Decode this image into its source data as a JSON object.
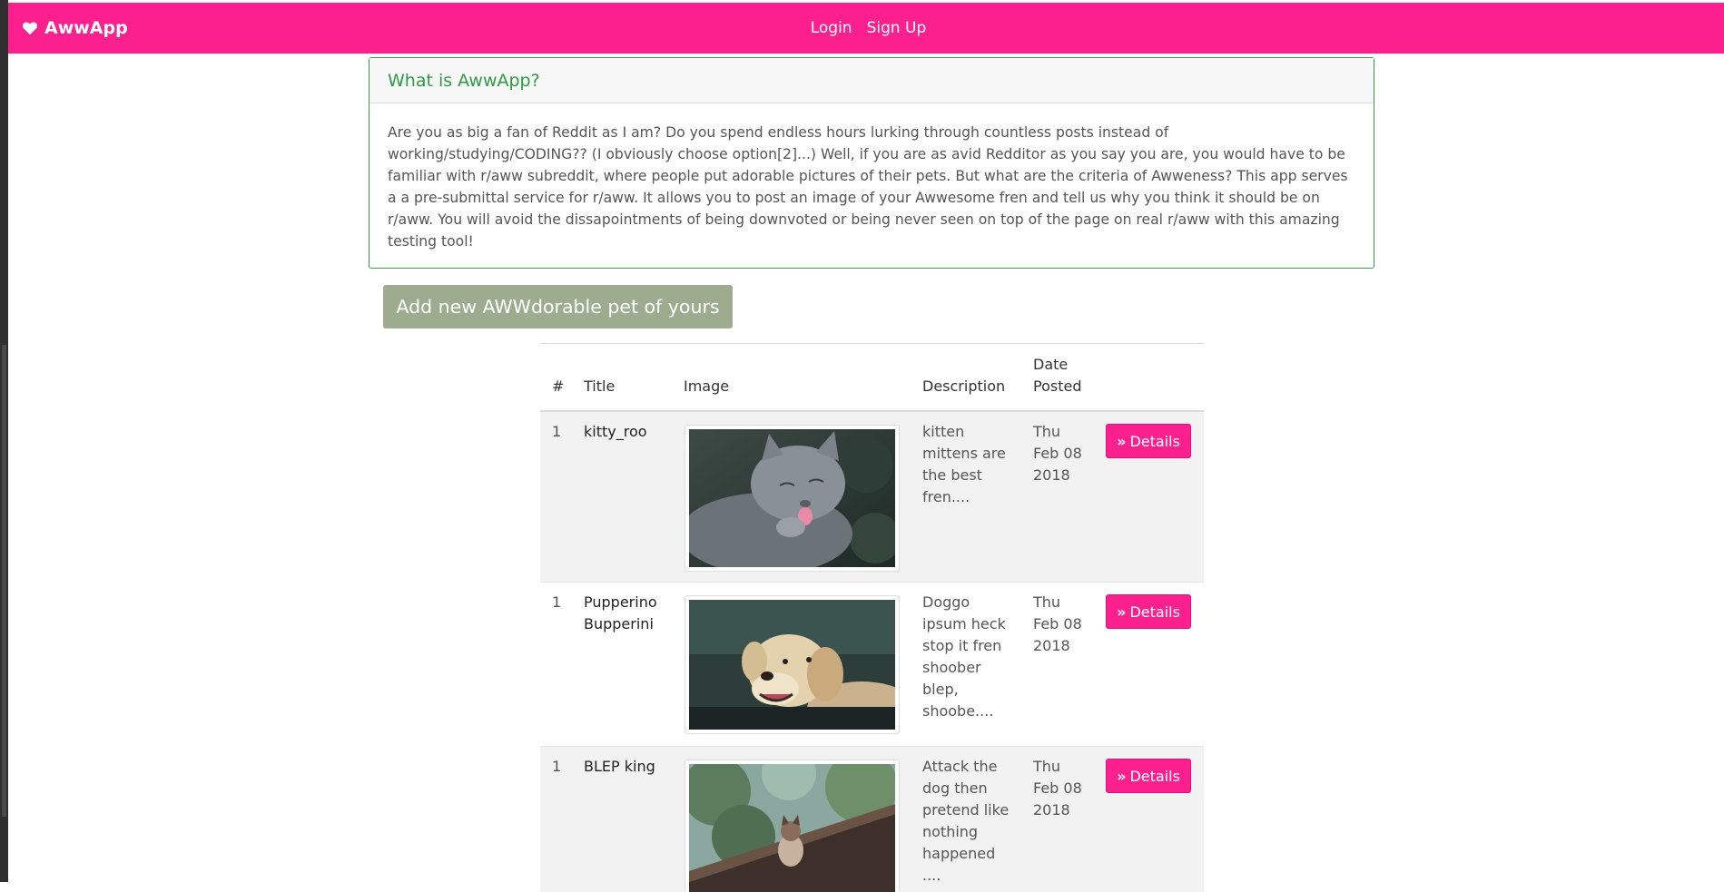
{
  "nav": {
    "brand": "AwwApp",
    "login": "Login",
    "signup": "Sign Up"
  },
  "intro": {
    "heading": "What is AwwApp?",
    "body": "Are you as big a fan of Reddit as I am? Do you spend endless hours lurking through countless posts instead of working/studying/CODING?? (I obviously choose option[2]...) Well, if you are as avid Redditor as you say you are, you would have to be familiar with r/aww subreddit, where people put adorable pictures of their pets. But what are the criteria of Awweness? This app serves a a pre-submittal service for r/aww. It allows you to post an image of your Awwesome fren and tell us why you think it should be on r/aww. You will avoid the dissapointments of being downvoted or being never seen on top of the page on real r/aww with this amazing testing tool!"
  },
  "add_button": "Add new AWWdorable pet of yours",
  "table": {
    "headers": {
      "num": "#",
      "title": "Title",
      "image": "Image",
      "description": "Description",
      "date_line1": "Date",
      "date_line2": "Posted"
    },
    "rows": [
      {
        "num": "1",
        "title": "kitty_roo",
        "image_icon": "cat-photo",
        "desc_lines": [
          "kitten",
          "mittens are",
          "the best",
          "fren...."
        ],
        "date_lines": [
          "Thu",
          "Feb 08",
          "2018"
        ],
        "details_label": "Details"
      },
      {
        "num": "1",
        "title_lines": [
          "Pupperino",
          "Bupperini"
        ],
        "image_icon": "dog-photo",
        "desc_lines": [
          "Doggo",
          "ipsum heck",
          "stop it fren",
          "shoober",
          "blep,",
          "shoobe...."
        ],
        "date_lines": [
          "Thu",
          "Feb 08",
          "2018"
        ],
        "details_label": "Details"
      },
      {
        "num": "1",
        "title": "BLEP king",
        "image_icon": "cat-on-roof-photo",
        "desc_lines": [
          "Attack the",
          "dog then",
          "pretend like",
          "nothing",
          "happened",
          "...."
        ],
        "date_lines": [
          "Thu",
          "Feb 08",
          "2018"
        ],
        "details_label": "Details"
      }
    ]
  },
  "colors": {
    "navbar": "#fc208e",
    "card_border": "#3a9a4a",
    "heading_green": "#2f9a44",
    "add_button": "#9dab8e",
    "details_button": "#fc208e"
  }
}
